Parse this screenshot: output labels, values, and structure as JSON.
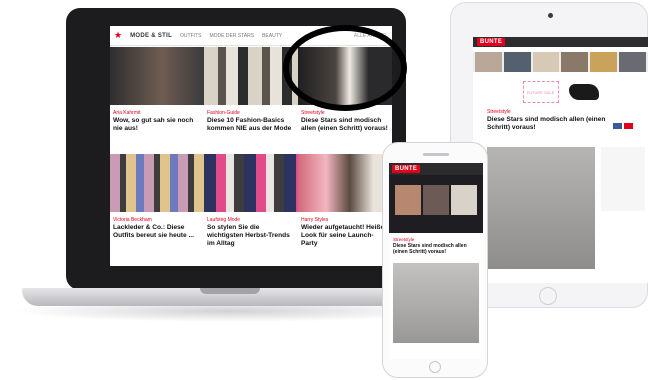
{
  "colors": {
    "brand_red": "#e2001a",
    "laptop_frame": "#1c1c1e",
    "device_silver": "#f4f4f6"
  },
  "laptop": {
    "nav": {
      "star_icon": "star-icon",
      "brand": "MODE & STIL",
      "links": [
        "OUTFITS",
        "MODE DER STARS",
        "BEAUTY"
      ],
      "more": "ALLE ARTIKEL"
    },
    "articles": [
      {
        "kicker": "Aria Kahrmit",
        "headline": "Wow, so gut sah sie noch nie aus!"
      },
      {
        "kicker": "Fashion-Guide",
        "headline": "Diese 10 Fashion-Basics kommen NIE aus der Mode"
      },
      {
        "kicker": "Streetstyle",
        "headline": "Diese Stars sind modisch allen (einen Schritt) voraus!"
      },
      {
        "kicker": "Victoria Beckham",
        "headline": "Lackleder & Co.: Diese Outfits bereut sie heute ..."
      },
      {
        "kicker": "Laufsteg Mode",
        "headline": "So stylen Sie die wichtigsten Herbst-Trends im Alltag"
      },
      {
        "kicker": "Harry Styles",
        "headline": "Wieder aufgetaucht! Heißer Look für seine Launch-Party"
      }
    ]
  },
  "tablet": {
    "logo": "BUNTE",
    "ad_text": "FUTURE SALE",
    "kicker": "Streetstyle",
    "headline": "Diese Stars sind modisch allen (einen Schritt) voraus!"
  },
  "phone": {
    "logo": "BUNTE",
    "kicker": "Streetstyle",
    "headline": "Diese Stars sind modisch allen (einen Schritt) voraus!"
  }
}
